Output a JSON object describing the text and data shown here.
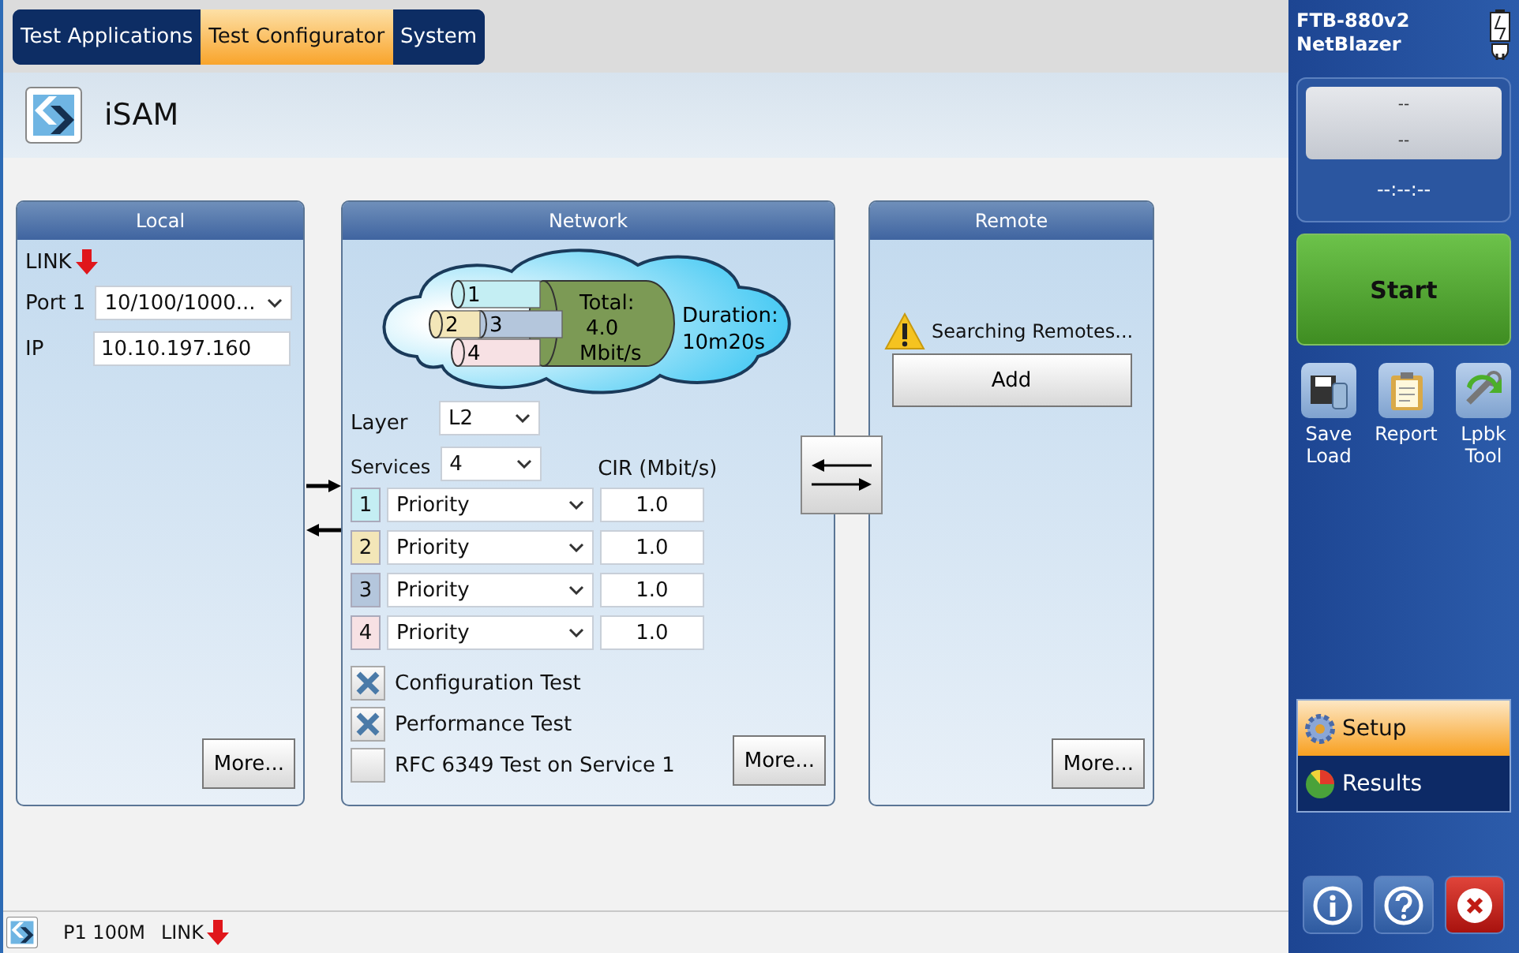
{
  "tabs": [
    {
      "label": "Test Applications",
      "selected": false
    },
    {
      "label": "Test Configurator",
      "selected": true
    },
    {
      "label": "System",
      "selected": false
    }
  ],
  "header": {
    "title": "iSAM"
  },
  "local": {
    "title": "Local",
    "link_label": "LINK",
    "port_label": "Port 1",
    "port_value": "10/100/1000...",
    "ip_label": "IP",
    "ip_value": "10.10.197.160",
    "more": "More..."
  },
  "network": {
    "title": "Network",
    "cloud": {
      "tube_labels": [
        "1",
        "2",
        "3",
        "4"
      ],
      "total_label": "Total:",
      "total_value": "4.0",
      "total_unit": "Mbit/s",
      "duration_label": "Duration:",
      "duration_value": "10m20s"
    },
    "layer_label": "Layer",
    "layer_value": "L2",
    "services_label": "Services",
    "services_value": "4",
    "cir_header": "CIR (Mbit/s)",
    "services": [
      {
        "number": "1",
        "type": "Priority",
        "cir": "1.0",
        "color": "#c4eef3"
      },
      {
        "number": "2",
        "type": "Priority",
        "cir": "1.0",
        "color": "#f3e6b8"
      },
      {
        "number": "3",
        "type": "Priority",
        "cir": "1.0",
        "color": "#b4c6dc"
      },
      {
        "number": "4",
        "type": "Priority",
        "cir": "1.0",
        "color": "#f7e1e4"
      }
    ],
    "tests": [
      {
        "label": "Configuration Test",
        "checked": true
      },
      {
        "label": "Performance Test",
        "checked": true
      },
      {
        "label": "RFC 6349 Test on Service 1",
        "checked": false
      }
    ],
    "more": "More..."
  },
  "remote": {
    "title": "Remote",
    "status": "Searching Remotes...",
    "add": "Add",
    "more": "More..."
  },
  "sidebar": {
    "model": "FTB-880v2",
    "product": "NetBlazer",
    "display": [
      "--",
      "--"
    ],
    "timer": "--:--:--",
    "start": "Start",
    "tools": [
      {
        "kind": "save",
        "lines": [
          "Save",
          "Load"
        ]
      },
      {
        "kind": "report",
        "lines": [
          "Report"
        ]
      },
      {
        "kind": "loopback",
        "lines": [
          "Lpbk",
          "Tool"
        ]
      }
    ],
    "nav": [
      {
        "kind": "setup",
        "label": "Setup",
        "selected": true
      },
      {
        "kind": "results",
        "label": "Results",
        "selected": false
      }
    ],
    "buttons": [
      {
        "kind": "info"
      },
      {
        "kind": "help"
      },
      {
        "kind": "exit"
      }
    ]
  },
  "status_bar": {
    "port": "P1 100M",
    "link": "LINK"
  }
}
